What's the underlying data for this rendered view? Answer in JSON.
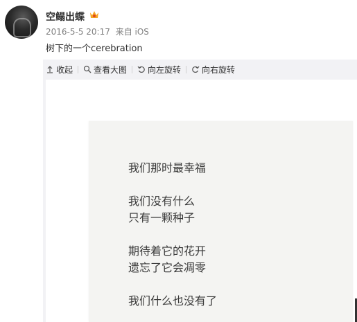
{
  "post": {
    "username": "空鳎出蝶",
    "timestamp": "2016-5-5 20:17",
    "source": "来自 iOS",
    "text": "树下的一个cerebration",
    "badge_icon": "vip-crown-icon"
  },
  "toolbar": {
    "collapse": "收起",
    "view_large": "查看大图",
    "rotate_left": "向左旋转",
    "rotate_right": "向右旋转"
  },
  "photo_text": {
    "line1": "我们那时最幸福",
    "line2": "我们没有什么",
    "line3": "只有一颗种子",
    "line4": "期待着它的花开",
    "line5": "遗忘了它会凋零",
    "line6": "我们什么也没有了"
  },
  "colors": {
    "panel_bg": "#f2f2f5",
    "meta_text": "#808080",
    "badge": "#f5a623"
  }
}
